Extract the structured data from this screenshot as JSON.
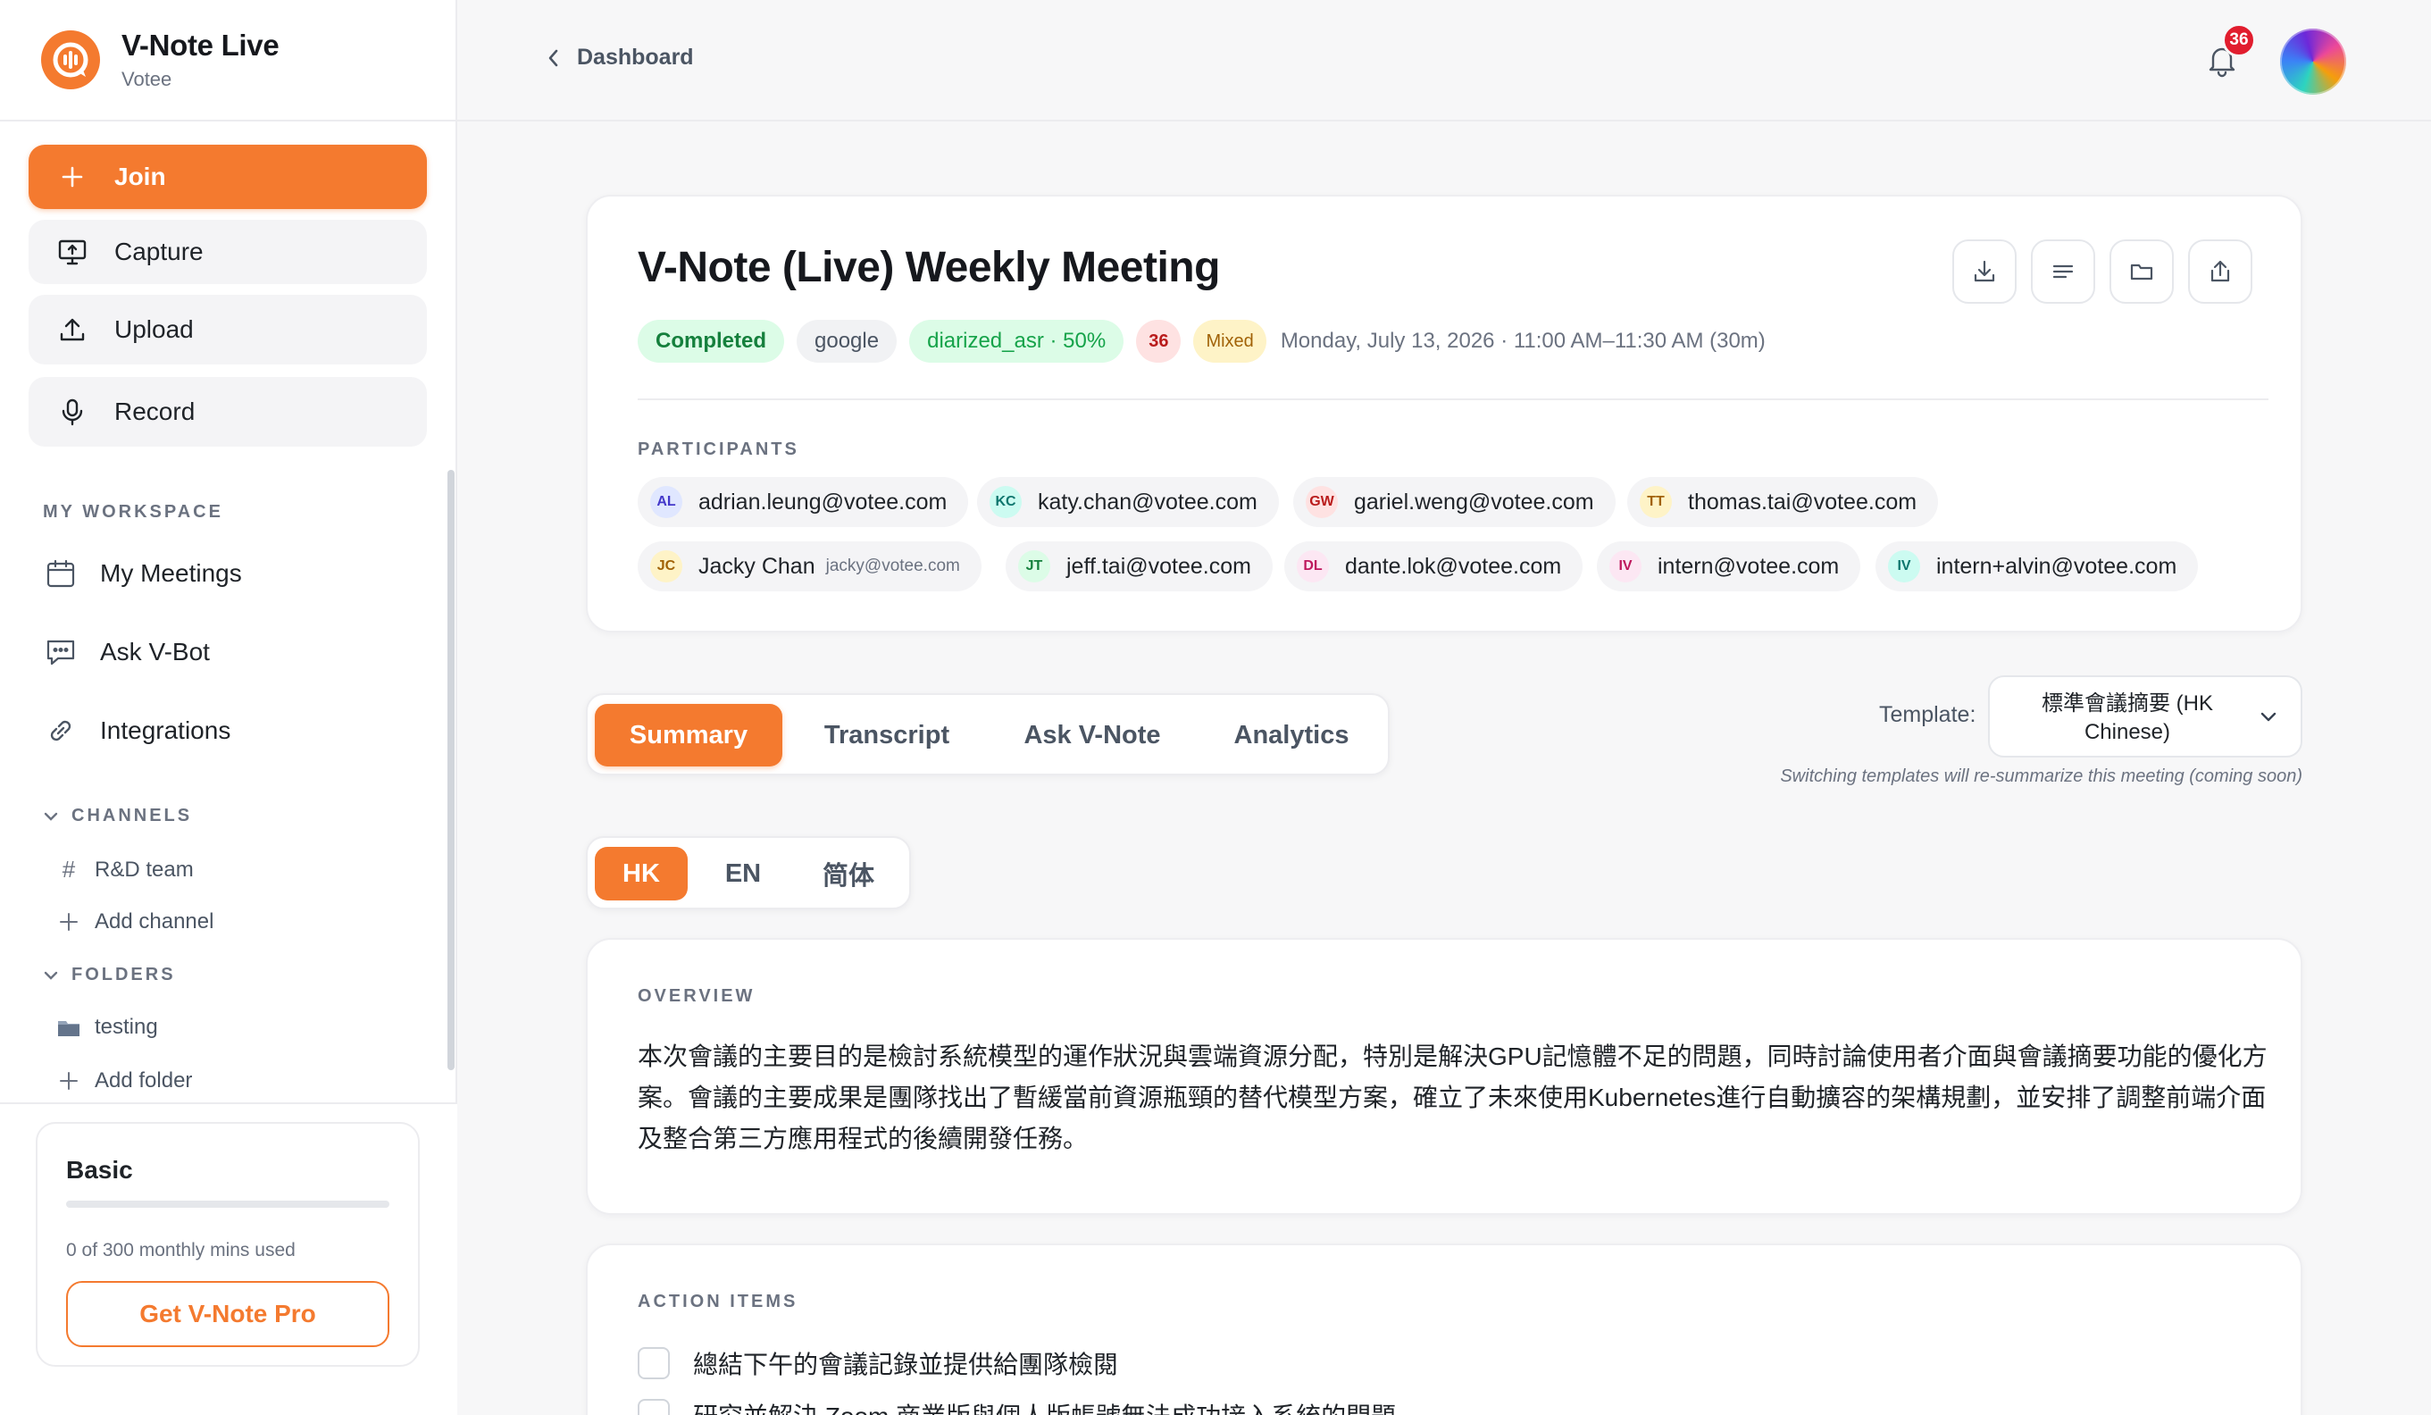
{
  "app": {
    "name": "V-Note Live",
    "workspace": "Votee"
  },
  "sidebar": {
    "actions": [
      {
        "label": "Join",
        "icon": "plus-icon"
      },
      {
        "label": "Capture",
        "icon": "monitor-upload-icon"
      },
      {
        "label": "Upload",
        "icon": "upload-icon"
      },
      {
        "label": "Record",
        "icon": "microphone-icon"
      }
    ],
    "workspace_label": "MY WORKSPACE",
    "workspace_items": [
      {
        "label": "My Meetings",
        "icon": "calendar-icon"
      },
      {
        "label": "Ask V-Bot",
        "icon": "chat-icon"
      },
      {
        "label": "Integrations",
        "icon": "link-icon"
      }
    ],
    "channels_label": "CHANNELS",
    "channels": [
      {
        "label": "R&D team"
      }
    ],
    "add_channel": "Add channel",
    "folders_label": "FOLDERS",
    "folders": [
      {
        "label": "testing"
      }
    ],
    "add_folder": "Add folder",
    "plan": {
      "name": "Basic",
      "usage": "0 of 300 monthly mins used",
      "used_fraction": 0,
      "cta": "Get V-Note Pro"
    }
  },
  "topbar": {
    "breadcrumb": "Dashboard",
    "notification_count": "36"
  },
  "meeting": {
    "title": "V-Note (Live) Weekly Meeting",
    "status": "Completed",
    "source": "google",
    "pipeline": "diarized_asr · 50%",
    "count_badge": "36",
    "language_badge": "Mixed",
    "datetime": "Monday, July 13, 2026 · 11:00 AM–11:30 AM (30m)",
    "participants_label": "PARTICIPANTS",
    "participants": [
      {
        "initials": "AL",
        "email": "adrian.leung@votee.com",
        "color": "#e0e7ff",
        "text": "#4338ca"
      },
      {
        "initials": "KC",
        "email": "katy.chan@votee.com",
        "color": "#ccfbf1",
        "text": "#0f766e"
      },
      {
        "initials": "GW",
        "email": "gariel.weng@votee.com",
        "color": "#fee2e2",
        "text": "#b91c1c"
      },
      {
        "initials": "TT",
        "email": "thomas.tai@votee.com",
        "color": "#fef3c7",
        "text": "#a16207"
      },
      {
        "initials": "JC",
        "name": "Jacky Chan",
        "email": "jacky@votee.com",
        "color": "#fef3c7",
        "text": "#a16207"
      },
      {
        "initials": "JT",
        "email": "jeff.tai@votee.com",
        "color": "#dcfce7",
        "text": "#15803d"
      },
      {
        "initials": "DL",
        "email": "dante.lok@votee.com",
        "color": "#fce7f3",
        "text": "#be185d"
      },
      {
        "initials": "IV",
        "email": "intern@votee.com",
        "color": "#fce7f3",
        "text": "#be185d"
      },
      {
        "initials": "IV",
        "email": "intern+alvin@votee.com",
        "color": "#ccfbf1",
        "text": "#0f766e"
      }
    ]
  },
  "tabs": [
    {
      "label": "Summary",
      "active": true
    },
    {
      "label": "Transcript"
    },
    {
      "label": "Ask V-Note"
    },
    {
      "label": "Analytics"
    }
  ],
  "template": {
    "label": "Template:",
    "value": "標準會議摘要 (HK Chinese)",
    "note": "Switching templates will re-summarize this meeting (coming soon)"
  },
  "languages": [
    {
      "label": "HK",
      "active": true
    },
    {
      "label": "EN"
    },
    {
      "label": "简体"
    }
  ],
  "overview": {
    "label": "OVERVIEW",
    "text": "本次會議的主要目的是檢討系統模型的運作狀況與雲端資源分配，特別是解決GPU記憶體不足的問題，同時討論使用者介面與會議摘要功能的優化方案。會議的主要成果是團隊找出了暫緩當前資源瓶頸的替代模型方案，確立了未來使用Kubernetes進行自動擴容的架構規劃，並安排了調整前端介面及整合第三方應用程式的後續開發任務。"
  },
  "action_items": {
    "label": "ACTION ITEMS",
    "items": [
      {
        "text": "總結下午的會議記錄並提供給團隊檢閱"
      },
      {
        "text": "研究並解決 Zoom 商業版與個人版帳號無法成功接入系統的問題"
      }
    ]
  },
  "colors": {
    "accent": "#f47a2f",
    "success": "#15803d",
    "danger": "#e11d2e"
  }
}
